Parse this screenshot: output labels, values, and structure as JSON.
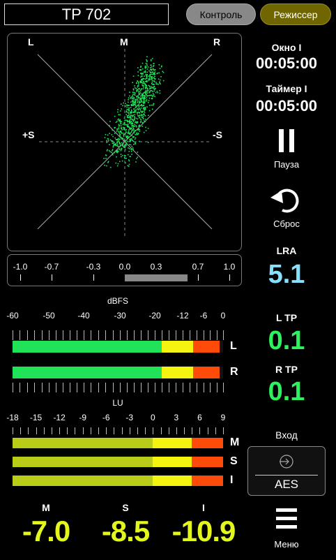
{
  "header": {
    "title": "TP 702",
    "control_label": "Контроль",
    "director_label": "Режиссер"
  },
  "vectorscope": {
    "labels": {
      "l": "L",
      "m": "M",
      "r": "R",
      "plus_s": "+S",
      "minus_s": "-S"
    }
  },
  "correlation": {
    "ticks": [
      "-1.0",
      "-0.7",
      "-0.3",
      "0.0",
      "0.3",
      "0.7",
      "1.0"
    ],
    "range": [
      0.0,
      0.6
    ]
  },
  "dbfs": {
    "title": "dBFS",
    "ticks": [
      "-60",
      "-50",
      "-40",
      "-30",
      "-20",
      "-12",
      "-6",
      "0"
    ],
    "channels": [
      {
        "label": "L",
        "level_db": -1
      },
      {
        "label": "R",
        "level_db": -1
      }
    ]
  },
  "lu": {
    "title": "LU",
    "ticks": [
      "-18",
      "-15",
      "-12",
      "-9",
      "-6",
      "-3",
      "0",
      "3",
      "6",
      "9"
    ],
    "channels": [
      {
        "label": "M",
        "level_lu": 9
      },
      {
        "label": "S",
        "level_lu": 9
      },
      {
        "label": "I",
        "level_lu": 9
      }
    ]
  },
  "side": {
    "window_title": "Окно I",
    "window_time": "00:05:00",
    "timer_title": "Таймер I",
    "timer_time": "00:05:00",
    "pause_label": "Пауза",
    "reset_label": "Сброс",
    "lra_title": "LRA",
    "lra_value": "5.1",
    "ltp_title": "L TP",
    "ltp_value": "0.1",
    "rtp_title": "R TP",
    "rtp_value": "0.1",
    "input_title": "Вход",
    "input_value": "AES",
    "menu_label": "Меню"
  },
  "bottom": {
    "m_label": "M",
    "m_value": "-7.0",
    "s_label": "S",
    "s_value": "-8.5",
    "i_label": "I",
    "i_value": "-10.9"
  },
  "colors": {
    "green": "#21e35a",
    "yellow": "#f4f410",
    "orange": "#ff4b0a",
    "lu_olive": "#b8cc18",
    "lra_blue": "#86e0ff",
    "tp_green": "#2cf25e",
    "bottom_yellow": "#e4f71c"
  }
}
